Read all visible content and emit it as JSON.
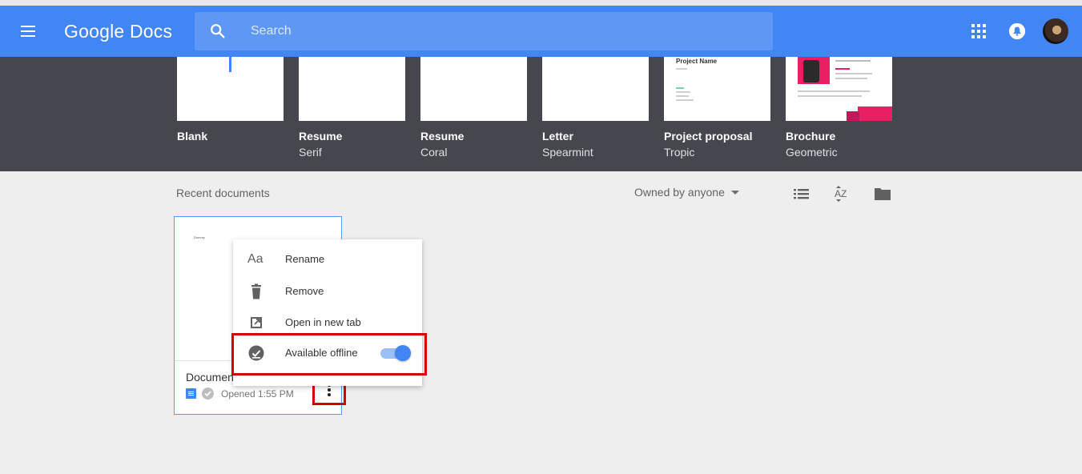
{
  "header": {
    "app_title": "Google Docs",
    "search_placeholder": "Search",
    "bar_color": "#4285f4"
  },
  "templates": [
    {
      "name": "Blank",
      "subtitle": ""
    },
    {
      "name": "Resume",
      "subtitle": "Serif"
    },
    {
      "name": "Resume",
      "subtitle": "Coral"
    },
    {
      "name": "Letter",
      "subtitle": "Spearmint"
    },
    {
      "name": "Project proposal",
      "subtitle": "Tropic",
      "thumb_text": "Project Name"
    },
    {
      "name": "Brochure",
      "subtitle": "Geometric"
    }
  ],
  "recent": {
    "label": "Recent documents",
    "owner_filter": "Owned by anyone"
  },
  "document": {
    "title": "Document",
    "preview_text": "Dummy",
    "opened_label": "Opened",
    "opened_time": "1:55 PM"
  },
  "context_menu": {
    "items": [
      {
        "label": "Rename",
        "icon": "text-format-icon"
      },
      {
        "label": "Remove",
        "icon": "trash-icon"
      },
      {
        "label": "Open in new tab",
        "icon": "open-in-new-icon"
      },
      {
        "label": "Available offline",
        "icon": "offline-check-icon",
        "toggle_on": true
      }
    ]
  },
  "colors": {
    "template_band": "#45464e",
    "highlight": "#d40000",
    "toggle_on": "#4285f4"
  }
}
